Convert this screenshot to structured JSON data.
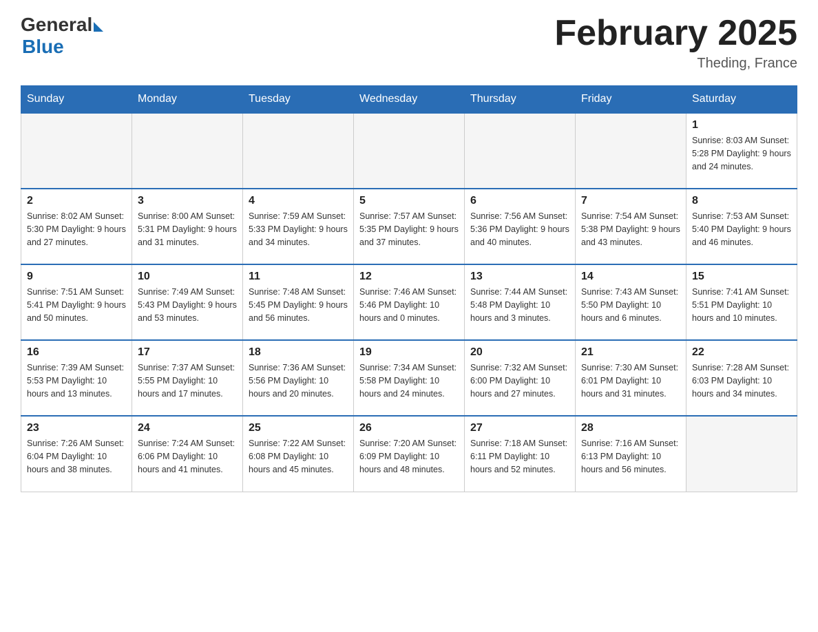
{
  "header": {
    "logo_general": "General",
    "logo_blue": "Blue",
    "title": "February 2025",
    "location": "Theding, France"
  },
  "days_of_week": [
    "Sunday",
    "Monday",
    "Tuesday",
    "Wednesday",
    "Thursday",
    "Friday",
    "Saturday"
  ],
  "weeks": [
    [
      {
        "day": "",
        "info": ""
      },
      {
        "day": "",
        "info": ""
      },
      {
        "day": "",
        "info": ""
      },
      {
        "day": "",
        "info": ""
      },
      {
        "day": "",
        "info": ""
      },
      {
        "day": "",
        "info": ""
      },
      {
        "day": "1",
        "info": "Sunrise: 8:03 AM\nSunset: 5:28 PM\nDaylight: 9 hours\nand 24 minutes."
      }
    ],
    [
      {
        "day": "2",
        "info": "Sunrise: 8:02 AM\nSunset: 5:30 PM\nDaylight: 9 hours\nand 27 minutes."
      },
      {
        "day": "3",
        "info": "Sunrise: 8:00 AM\nSunset: 5:31 PM\nDaylight: 9 hours\nand 31 minutes."
      },
      {
        "day": "4",
        "info": "Sunrise: 7:59 AM\nSunset: 5:33 PM\nDaylight: 9 hours\nand 34 minutes."
      },
      {
        "day": "5",
        "info": "Sunrise: 7:57 AM\nSunset: 5:35 PM\nDaylight: 9 hours\nand 37 minutes."
      },
      {
        "day": "6",
        "info": "Sunrise: 7:56 AM\nSunset: 5:36 PM\nDaylight: 9 hours\nand 40 minutes."
      },
      {
        "day": "7",
        "info": "Sunrise: 7:54 AM\nSunset: 5:38 PM\nDaylight: 9 hours\nand 43 minutes."
      },
      {
        "day": "8",
        "info": "Sunrise: 7:53 AM\nSunset: 5:40 PM\nDaylight: 9 hours\nand 46 minutes."
      }
    ],
    [
      {
        "day": "9",
        "info": "Sunrise: 7:51 AM\nSunset: 5:41 PM\nDaylight: 9 hours\nand 50 minutes."
      },
      {
        "day": "10",
        "info": "Sunrise: 7:49 AM\nSunset: 5:43 PM\nDaylight: 9 hours\nand 53 minutes."
      },
      {
        "day": "11",
        "info": "Sunrise: 7:48 AM\nSunset: 5:45 PM\nDaylight: 9 hours\nand 56 minutes."
      },
      {
        "day": "12",
        "info": "Sunrise: 7:46 AM\nSunset: 5:46 PM\nDaylight: 10 hours\nand 0 minutes."
      },
      {
        "day": "13",
        "info": "Sunrise: 7:44 AM\nSunset: 5:48 PM\nDaylight: 10 hours\nand 3 minutes."
      },
      {
        "day": "14",
        "info": "Sunrise: 7:43 AM\nSunset: 5:50 PM\nDaylight: 10 hours\nand 6 minutes."
      },
      {
        "day": "15",
        "info": "Sunrise: 7:41 AM\nSunset: 5:51 PM\nDaylight: 10 hours\nand 10 minutes."
      }
    ],
    [
      {
        "day": "16",
        "info": "Sunrise: 7:39 AM\nSunset: 5:53 PM\nDaylight: 10 hours\nand 13 minutes."
      },
      {
        "day": "17",
        "info": "Sunrise: 7:37 AM\nSunset: 5:55 PM\nDaylight: 10 hours\nand 17 minutes."
      },
      {
        "day": "18",
        "info": "Sunrise: 7:36 AM\nSunset: 5:56 PM\nDaylight: 10 hours\nand 20 minutes."
      },
      {
        "day": "19",
        "info": "Sunrise: 7:34 AM\nSunset: 5:58 PM\nDaylight: 10 hours\nand 24 minutes."
      },
      {
        "day": "20",
        "info": "Sunrise: 7:32 AM\nSunset: 6:00 PM\nDaylight: 10 hours\nand 27 minutes."
      },
      {
        "day": "21",
        "info": "Sunrise: 7:30 AM\nSunset: 6:01 PM\nDaylight: 10 hours\nand 31 minutes."
      },
      {
        "day": "22",
        "info": "Sunrise: 7:28 AM\nSunset: 6:03 PM\nDaylight: 10 hours\nand 34 minutes."
      }
    ],
    [
      {
        "day": "23",
        "info": "Sunrise: 7:26 AM\nSunset: 6:04 PM\nDaylight: 10 hours\nand 38 minutes."
      },
      {
        "day": "24",
        "info": "Sunrise: 7:24 AM\nSunset: 6:06 PM\nDaylight: 10 hours\nand 41 minutes."
      },
      {
        "day": "25",
        "info": "Sunrise: 7:22 AM\nSunset: 6:08 PM\nDaylight: 10 hours\nand 45 minutes."
      },
      {
        "day": "26",
        "info": "Sunrise: 7:20 AM\nSunset: 6:09 PM\nDaylight: 10 hours\nand 48 minutes."
      },
      {
        "day": "27",
        "info": "Sunrise: 7:18 AM\nSunset: 6:11 PM\nDaylight: 10 hours\nand 52 minutes."
      },
      {
        "day": "28",
        "info": "Sunrise: 7:16 AM\nSunset: 6:13 PM\nDaylight: 10 hours\nand 56 minutes."
      },
      {
        "day": "",
        "info": ""
      }
    ]
  ]
}
